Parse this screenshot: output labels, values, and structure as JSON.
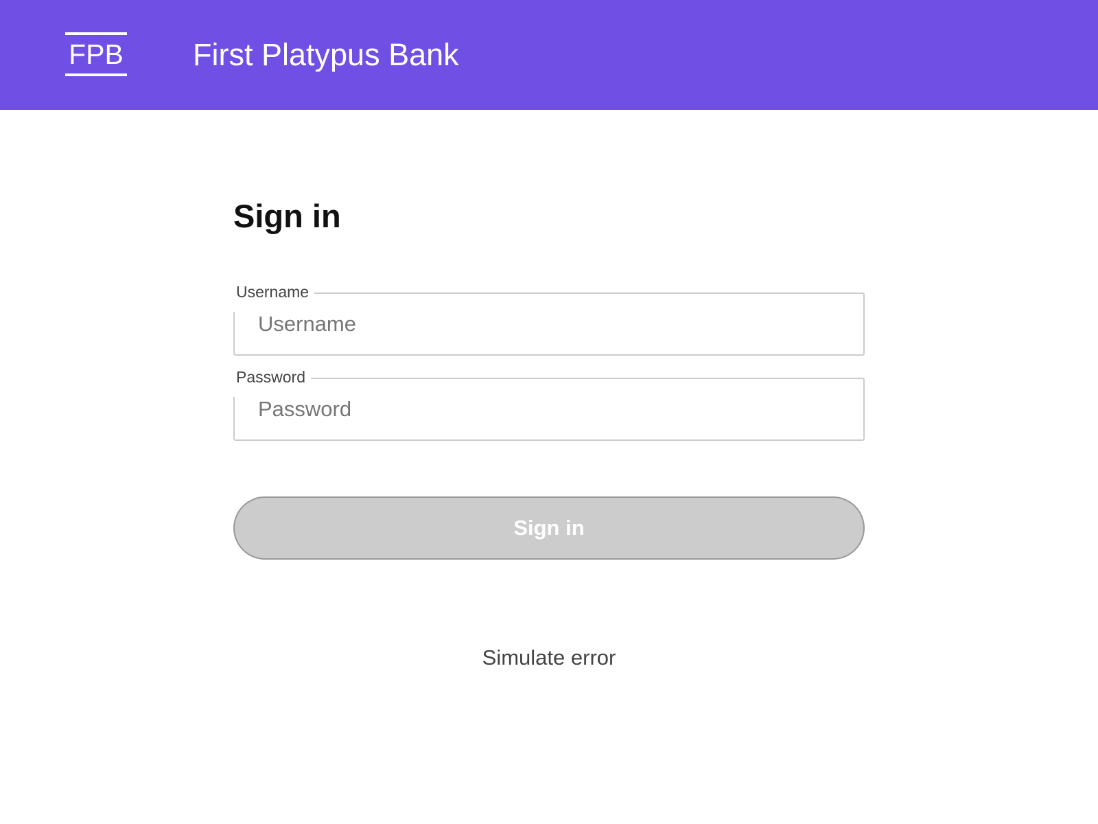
{
  "header": {
    "logo_text": "FPB",
    "bank_name": "First Platypus Bank",
    "background_color": "#704FE4"
  },
  "form": {
    "title": "Sign in",
    "username": {
      "label": "Username",
      "placeholder": "Username",
      "value": ""
    },
    "password": {
      "label": "Password",
      "placeholder": "Password",
      "value": ""
    },
    "submit_label": "Sign in",
    "submit_state": "disabled"
  },
  "footer": {
    "simulate_error_label": "Simulate error"
  }
}
